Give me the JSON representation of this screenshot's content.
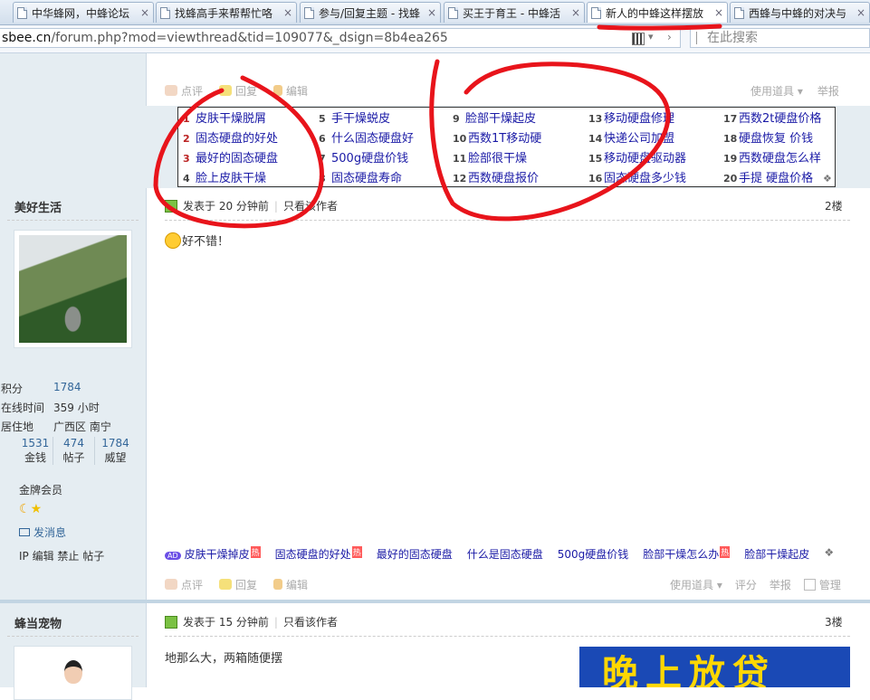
{
  "tabs": [
    {
      "title": "中华蜂网，中蜂论坛",
      "close": "×"
    },
    {
      "title": "找蜂高手来帮帮忙咯",
      "close": "×"
    },
    {
      "title": "参与/回复主题 - 找蜂",
      "close": "×"
    },
    {
      "title": "买王于育王 - 中蜂活",
      "close": "×"
    },
    {
      "title": "新人的中蜂这样摆放",
      "close": "×"
    },
    {
      "title": "西蜂与中蜂的对决与",
      "close": "×"
    }
  ],
  "address": {
    "url_host": "sbee.cn",
    "url_path": "/forum.php?mod=viewthread&tid=109077&_dsign=8b4ea265",
    "search_placeholder": "在此搜索"
  },
  "post_toolbar": {
    "rate": "点评",
    "reply": "回复",
    "edit": "编辑",
    "use_item": "使用道具",
    "report": "举报",
    "grade": "评分",
    "manage": "管理"
  },
  "keyword_box": [
    {
      "n": "1",
      "text": "皮肤干燥脱屑"
    },
    {
      "n": "2",
      "text": "固态硬盘的好处"
    },
    {
      "n": "3",
      "text": "最好的固态硬盘"
    },
    {
      "n": "4",
      "text": "脸上皮肤干燥"
    },
    {
      "n": "5",
      "text": "手干燥蜕皮"
    },
    {
      "n": "6",
      "text": "什么固态硬盘好"
    },
    {
      "n": "7",
      "text": "500g硬盘价钱"
    },
    {
      "n": "8",
      "text": "固态硬盘寿命"
    },
    {
      "n": "9",
      "text": "脸部干燥起皮"
    },
    {
      "n": "10",
      "text": "西数1T移动硬"
    },
    {
      "n": "11",
      "text": "脸部很干燥"
    },
    {
      "n": "12",
      "text": "西数硬盘报价"
    },
    {
      "n": "13",
      "text": "移动硬盘修理"
    },
    {
      "n": "14",
      "text": "快递公司加盟"
    },
    {
      "n": "15",
      "text": "移动硬盘驱动器"
    },
    {
      "n": "16",
      "text": "固态硬盘多少钱"
    },
    {
      "n": "17",
      "text": "西数2t硬盘价格"
    },
    {
      "n": "18",
      "text": "硬盘恢复 价钱"
    },
    {
      "n": "19",
      "text": "西数硬盘怎么样"
    },
    {
      "n": "20",
      "text": "手提 硬盘价格"
    }
  ],
  "post2": {
    "author": "美好生活",
    "posted": "发表于 20 分钟前",
    "only_author": "只看该作者",
    "floor": "2楼",
    "content": "好不错！",
    "stats": [
      {
        "label": "积分",
        "value": "1784"
      },
      {
        "label": "在线时间",
        "value": "359 小时"
      },
      {
        "label": "居住地",
        "value": "广西区 南宁"
      }
    ],
    "counters": [
      {
        "value": "1531",
        "label": "金钱"
      },
      {
        "value": "474",
        "label": "帖子"
      },
      {
        "value": "1784",
        "label": "威望"
      }
    ],
    "group": "金牌会员",
    "send_message": "发消息",
    "admin_links": "IP 编辑 禁止 帖子"
  },
  "ad_links": [
    {
      "text": "皮肤干燥掉皮",
      "hot": "热"
    },
    {
      "text": "固态硬盘的好处",
      "hot": "热"
    },
    {
      "text": "最好的固态硬盘",
      "hot": ""
    },
    {
      "text": "什么是固态硬盘",
      "hot": ""
    },
    {
      "text": "500g硬盘价钱",
      "hot": ""
    },
    {
      "text": "脸部干燥怎么办",
      "hot": "热"
    },
    {
      "text": "脸部干燥起皮",
      "hot": ""
    }
  ],
  "ad_badge": "AD",
  "post3": {
    "author": "蜂当宠物",
    "posted": "发表于 15 分钟前",
    "only_author": "只看该作者",
    "floor": "3楼",
    "content": "地那么大，两箱随便摆",
    "banner": "晚上放贷"
  },
  "colors": {
    "annotation": "#e8141b",
    "link": "#1a1aa6",
    "sidebar": "#e5edf2"
  }
}
